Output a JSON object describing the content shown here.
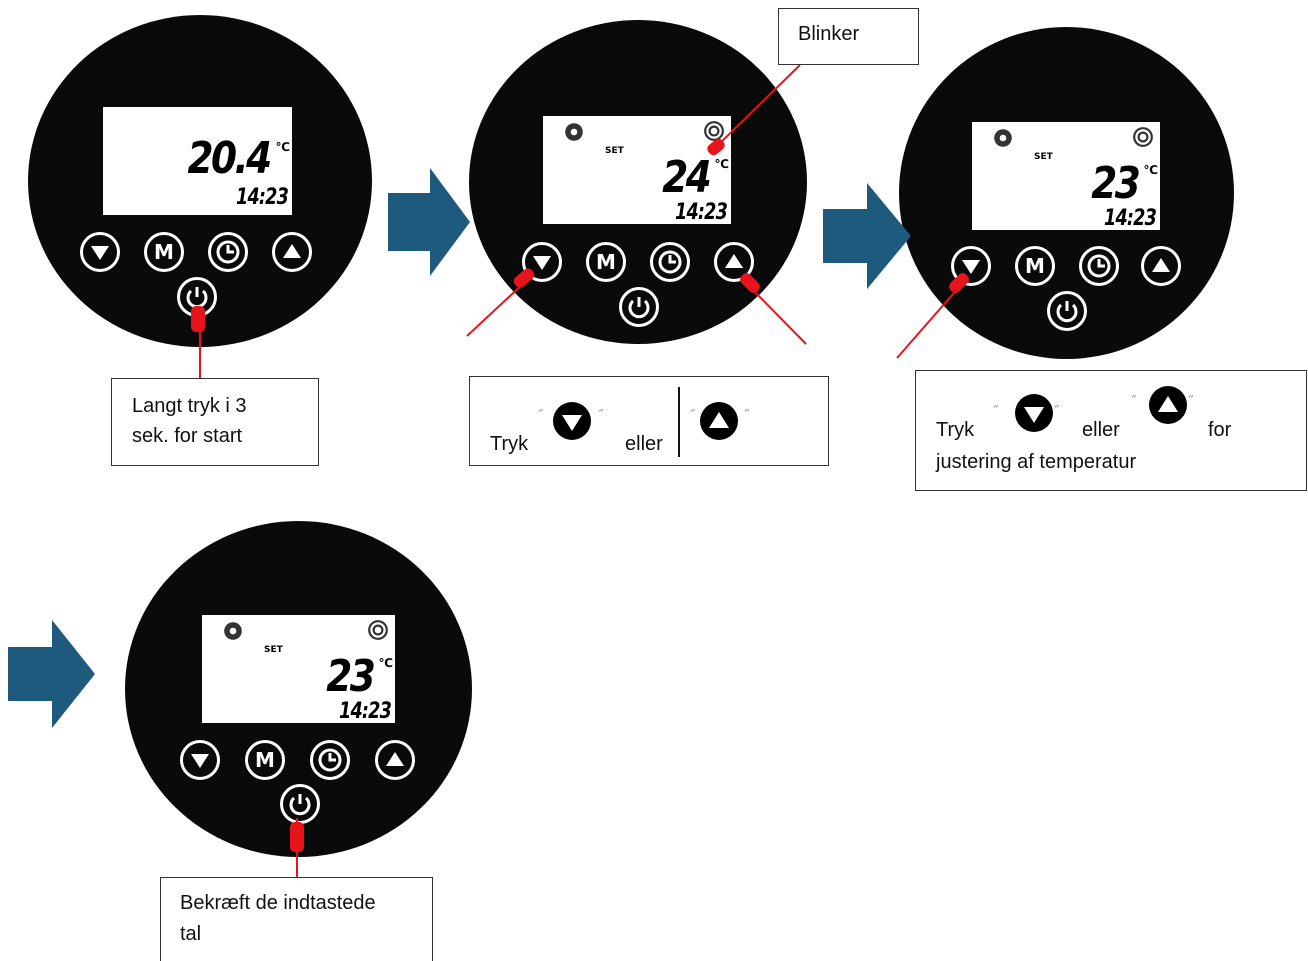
{
  "colors": {
    "device": "#0a0a0a",
    "screen": "#ffffff",
    "arrow": "#1d5a7e",
    "pointer": "#e8141c"
  },
  "icons": [
    "arrow-down-icon",
    "m-mode-icon",
    "clock-icon",
    "arrow-up-icon",
    "power-icon",
    "snowflake-icon",
    "fan-icon",
    "hand-pointer-icon",
    "flow-arrow-icon"
  ],
  "thermostats": [
    {
      "temp": "20.4",
      "unit": "℃",
      "time": "14:23",
      "set_label": ""
    },
    {
      "temp": "24",
      "unit": "℃",
      "time": "14:23",
      "set_label": "SET"
    },
    {
      "temp": "23",
      "unit": "℃",
      "time": "14:23",
      "set_label": "SET"
    },
    {
      "temp": "23",
      "unit": "℃",
      "time": "14:23",
      "set_label": "SET"
    }
  ],
  "buttons": {
    "mode_label": "M"
  },
  "callouts": {
    "start": {
      "line1": "Langt tryk i 3",
      "line2": "sek. for start"
    },
    "blink": {
      "text": "Blinker"
    },
    "press": {
      "word1": "Tryk",
      "word2": "eller"
    },
    "adjust": {
      "word1": "Tryk",
      "word2": "eller",
      "word3": "for",
      "line2": "justering af temperatur"
    },
    "confirm": {
      "line1": "Bekræft de indtastede",
      "line2": "tal"
    }
  }
}
